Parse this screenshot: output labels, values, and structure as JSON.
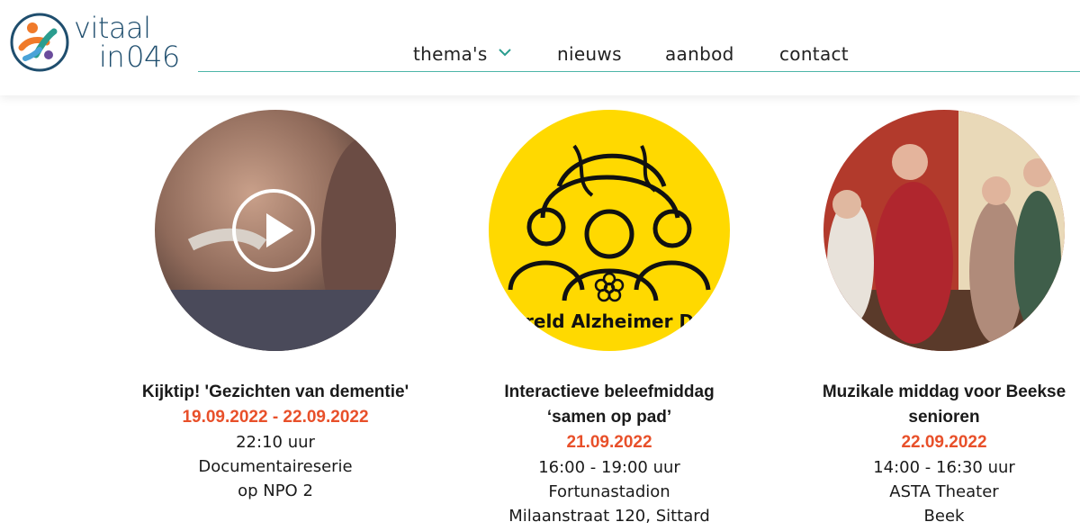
{
  "header": {
    "logo": {
      "word_line1": "vitaal",
      "word_line2_a": "in",
      "word_line2_b": "046"
    },
    "nav": [
      {
        "label": "thema's",
        "has_dropdown": true
      },
      {
        "label": "nieuws"
      },
      {
        "label": "aanbod"
      },
      {
        "label": "contact"
      }
    ],
    "colors": {
      "accent": "#4db6a8",
      "logo_text": "#1f4e6e",
      "date": "#e8502a"
    }
  },
  "events": [
    {
      "image_label": "",
      "title": "Kijktip! 'Gezichten van dementie'",
      "date": "19.09.2022 - 22.09.2022",
      "time": "22:10 uur",
      "location_1": "Documentaireserie",
      "location_2": "op NPO 2",
      "has_video": true
    },
    {
      "image_label": "ereld Alzheimer Da",
      "title": "Interactieve beleefmiddag ‘samen op pad’",
      "date": "21.09.2022",
      "time": "16:00 - 19:00 uur",
      "location_1": "Fortunastadion",
      "location_2": "Milaanstraat 120, Sittard"
    },
    {
      "image_label": "",
      "title": "Muzikale middag voor Beekse senioren",
      "date": "22.09.2022",
      "time": "14:00 - 16:30 uur",
      "location_1": "ASTA Theater",
      "location_2": "Beek"
    }
  ]
}
